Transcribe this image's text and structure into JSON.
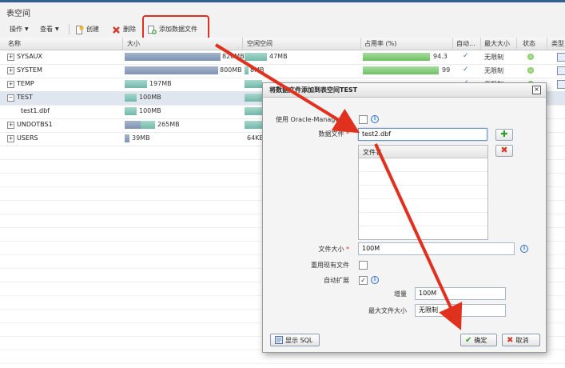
{
  "page": {
    "title": "表空间"
  },
  "toolbar": {
    "actions_label": "操作",
    "view_label": "查看",
    "create_label": "创建",
    "delete_label": "删除",
    "add_datafile_label": "添加数据文件"
  },
  "grid": {
    "headers": [
      "名称",
      "大小",
      "空闲空间",
      "占用率 (%)",
      "自动...",
      "最大大小",
      "状态",
      "类型"
    ],
    "rows": [
      {
        "name": "SYSAUX",
        "size": "820MB",
        "free": "47MB",
        "usage": "94.3",
        "auto": "✓",
        "max": "无限制"
      },
      {
        "name": "SYSTEM",
        "size": "800MB",
        "free": "8MB",
        "usage": "99",
        "auto": "✓",
        "max": "无限制"
      },
      {
        "name": "TEMP",
        "size": "197MB",
        "free": "197MB",
        "usage": "",
        "auto": "✓",
        "max": "无限制"
      },
      {
        "name": "TEST",
        "size": "100MB",
        "free": "",
        "usage": "",
        "auto": "",
        "max": ""
      },
      {
        "name": "test1.dbf",
        "size": "100MB",
        "free": "",
        "usage": "",
        "auto": "",
        "max": ""
      },
      {
        "name": "UNDOTBS1",
        "size": "265MB",
        "free": "",
        "usage": "",
        "auto": "",
        "max": ""
      },
      {
        "name": "USERS",
        "size": "39MB",
        "free": "64KB",
        "usage": "",
        "auto": "",
        "max": ""
      }
    ],
    "usage_fraction": {
      "SYSAUX": 0.943,
      "SYSTEM": 0.99
    }
  },
  "dialog": {
    "title": "将数据文件添加到表空间TEST",
    "omf_label": "使用 Oracle-Managed",
    "datafile_label": "数据文件",
    "datafile_value": "test2.dbf",
    "filename_header": "文件名",
    "filesize_label": "文件大小",
    "filesize_value": "100M",
    "reuse_label": "重用现有文件",
    "autoextend_label": "自动扩展",
    "increment_label": "增量",
    "increment_value": "100M",
    "maxsize_label": "最大文件大小",
    "maxsize_value": "无限制",
    "show_sql_label": "显示 SQL",
    "ok_label": "确定",
    "cancel_label": "取消"
  },
  "colors": {
    "accent": "#2f5f94",
    "annotation": "#e0301e",
    "ok_green": "#2d9a2d",
    "cancel_red": "#d23a2a"
  }
}
